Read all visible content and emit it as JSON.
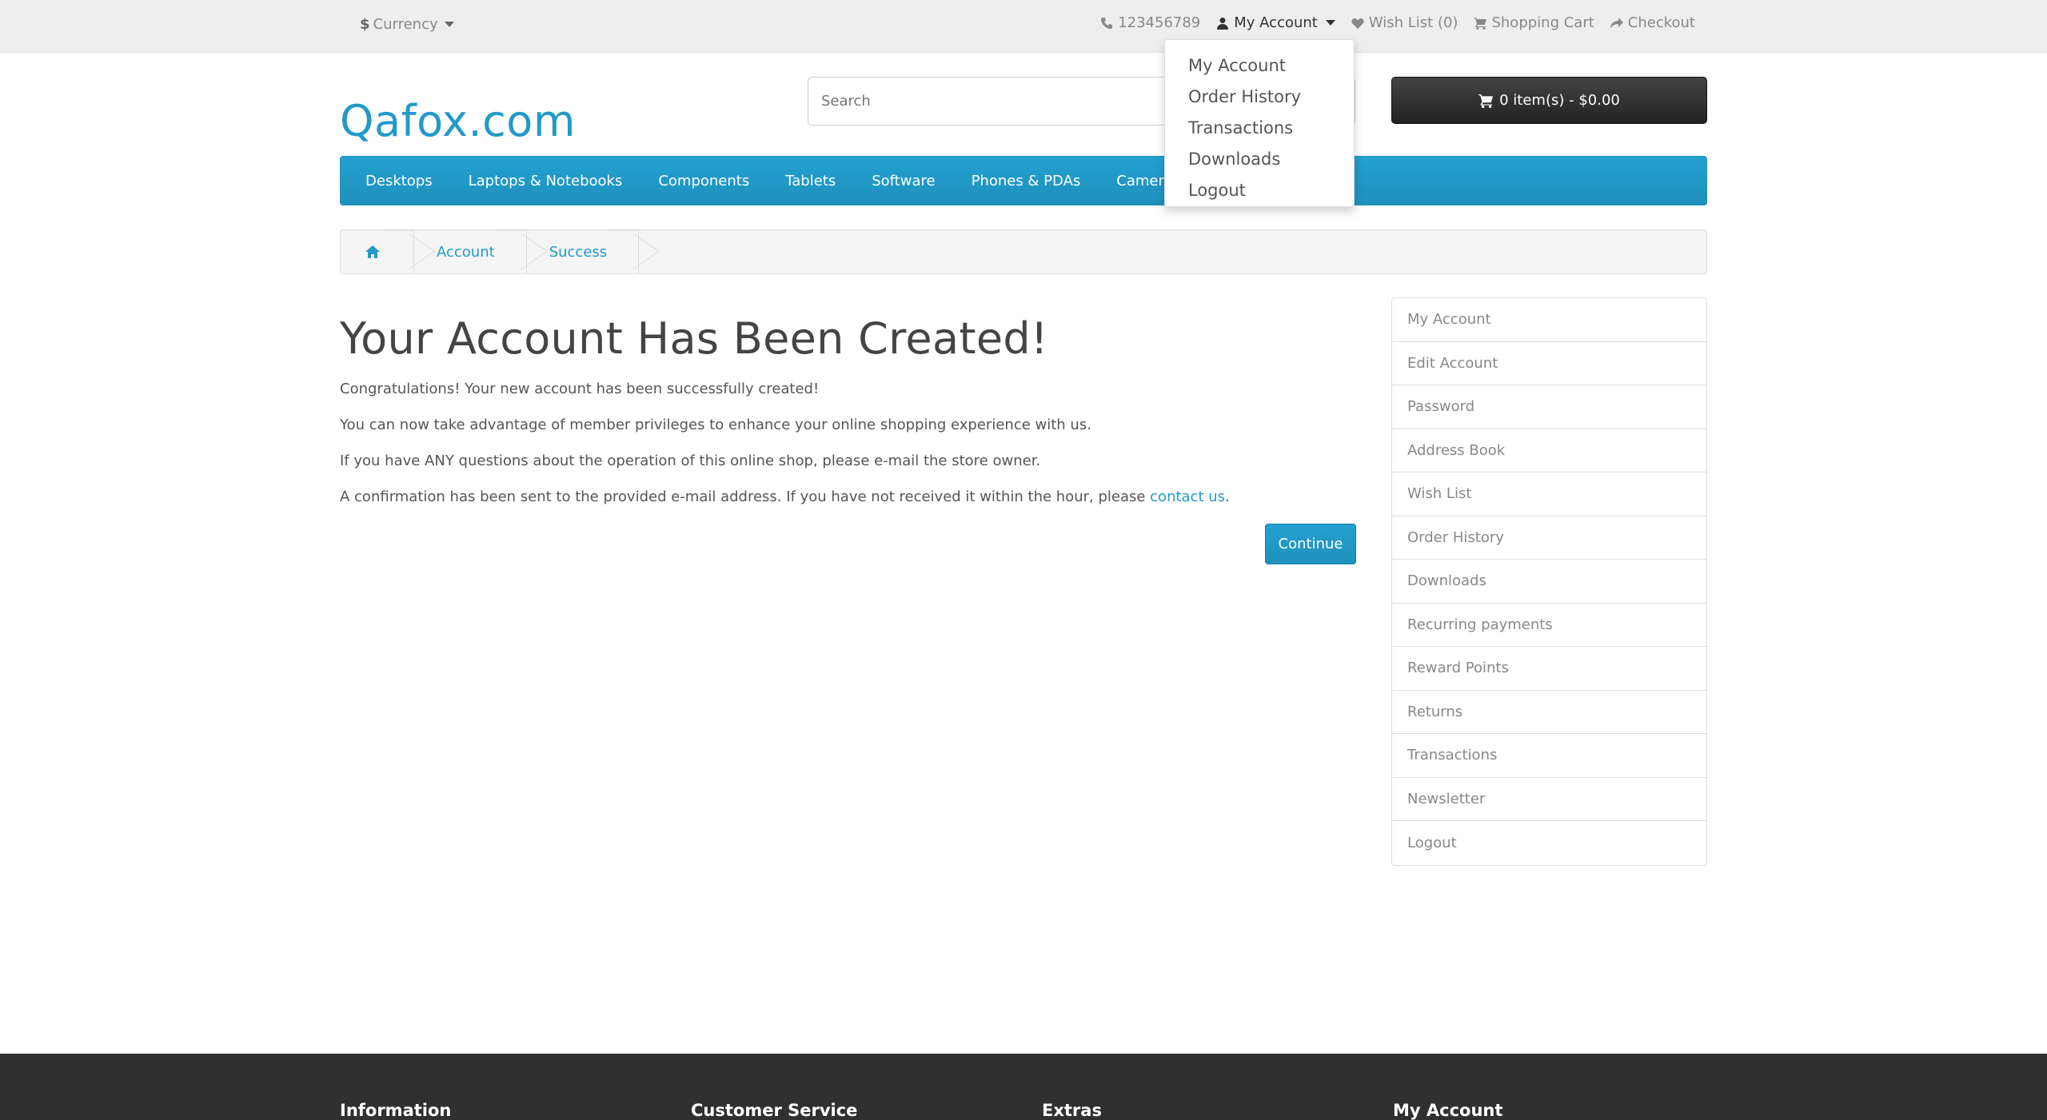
{
  "topbar": {
    "currency_symbol": "$",
    "currency_label": "Currency",
    "phone": "123456789",
    "my_account": "My Account",
    "wishlist": "Wish List (0)",
    "cart": "Shopping Cart",
    "checkout": "Checkout"
  },
  "header": {
    "logo": "Qafox.com",
    "search_placeholder": "Search",
    "cart_button": "0 item(s) - $0.00"
  },
  "nav": {
    "items": [
      "Desktops",
      "Laptops & Notebooks",
      "Components",
      "Tablets",
      "Software",
      "Phones & PDAs",
      "Cameras"
    ]
  },
  "breadcrumb": {
    "items": [
      "Account",
      "Success"
    ]
  },
  "main": {
    "title": "Your Account Has Been Created!",
    "p1": "Congratulations! Your new account has been successfully created!",
    "p2": "You can now take advantage of member privileges to enhance your online shopping experience with us.",
    "p3": "If you have ANY questions about the operation of this online shop, please e-mail the store owner.",
    "p4_prefix": "A confirmation has been sent to the provided e-mail address. If you have not received it within the hour, please ",
    "p4_link": "contact us",
    "p4_suffix": ".",
    "continue": "Continue"
  },
  "sidebar": {
    "items": [
      "My Account",
      "Edit Account",
      "Password",
      "Address Book",
      "Wish List",
      "Order History",
      "Downloads",
      "Recurring payments",
      "Reward Points",
      "Returns",
      "Transactions",
      "Newsletter",
      "Logout"
    ]
  },
  "dropdown": {
    "items": [
      "My Account",
      "Order History",
      "Transactions",
      "Downloads",
      "Logout"
    ]
  },
  "footer": {
    "columns": [
      "Information",
      "Customer Service",
      "Extras",
      "My Account"
    ]
  }
}
